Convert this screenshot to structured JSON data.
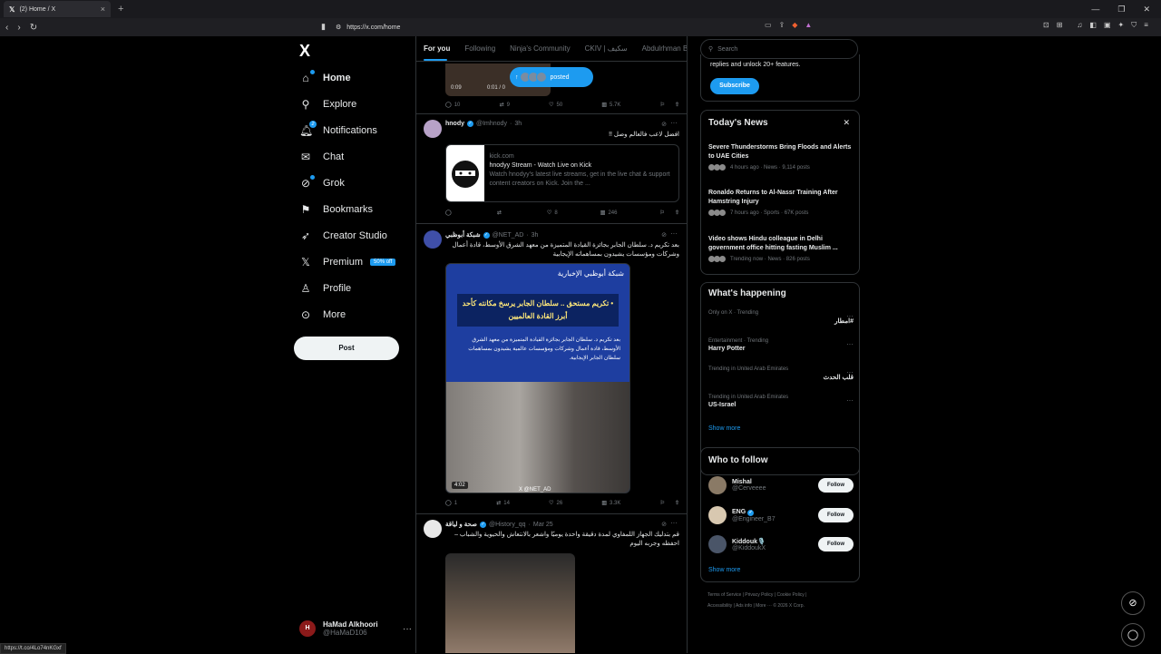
{
  "browser": {
    "tab_title": "(2) Home / X",
    "url": "https://x.com/home",
    "status_url": "https://t.co/4Lo74nKGxf"
  },
  "sidebar": {
    "logo": "X",
    "items": [
      {
        "label": "Home",
        "icon": "home-icon"
      },
      {
        "label": "Explore",
        "icon": "search-icon"
      },
      {
        "label": "Notifications",
        "icon": "bell-icon",
        "badge": "2"
      },
      {
        "label": "Chat",
        "icon": "mail-icon"
      },
      {
        "label": "Grok",
        "icon": "grok-icon"
      },
      {
        "label": "Bookmarks",
        "icon": "bookmark-icon"
      },
      {
        "label": "Creator Studio",
        "icon": "rocket-icon"
      },
      {
        "label": "Premium",
        "icon": "x-icon",
        "promo": "50% off"
      },
      {
        "label": "Profile",
        "icon": "person-icon"
      },
      {
        "label": "More",
        "icon": "more-circle-icon"
      }
    ],
    "post_label": "Post",
    "account": {
      "name": "HaMad Alkhoori",
      "handle": "@HaMaD106",
      "avatar_initials": "H"
    }
  },
  "main": {
    "tabs": [
      "For you",
      "Following",
      "Ninja's Community",
      "CKIV | سكيف",
      "Abdulrhman Bin"
    ],
    "posted_pill": "posted",
    "tweet0": {
      "video_time": "0:09",
      "video_progress": "0:01 / 0",
      "actions": {
        "replies": "10",
        "reposts": "9",
        "likes": "50",
        "views": "5.7K"
      }
    },
    "tweet1": {
      "name": "hnody",
      "handle": "@Imhnody",
      "time": "3h",
      "text": "افضل لاعب فالعالم وصل !!",
      "card": {
        "domain": "kick.com",
        "title": "hnodyy Stream - Watch Live on Kick",
        "desc": "Watch hnodyy's latest live streams, get in the live chat & support content creators on Kick. Join the ..."
      },
      "actions": {
        "replies": "",
        "reposts": "",
        "likes": "8",
        "views": "246"
      }
    },
    "tweet2": {
      "name": "شبكة أبوظبي",
      "handle": "@NET_AD",
      "time": "3h",
      "text": "بعد تكريم د. سلطان الجابر بجائزة القيادة المتميزة من معهد الشرق الأوسط، قادة أعمال وشركات ومؤسسات يشيدون بمساهماته الإيجابية",
      "media": {
        "brand": "شبكة أبوظبي الإخبارية",
        "headline": "• تكريم مستحق .. سلطان الجابر يرسخ مكانته كأحد أبرز القادة العالميين",
        "sub": "بعد تكريم د. سلطان الجابر بجائزة القيادة المتميزة من معهد الشرق الأوسط، قادة أعمال وشركات ومؤسسات عالمية يشيدون بمساهمات سلطان الجابر الإيجابية.",
        "duration": "4:02",
        "watermark": "X @NET_AD"
      },
      "actions": {
        "replies": "1",
        "reposts": "14",
        "likes": "26",
        "views": "3.3K"
      }
    },
    "tweet3": {
      "name": "صحة و لياقة",
      "handle": "@History_qq",
      "time": "Mar 25",
      "text": "قم بتدليك الجهاز اللمفاوي لمدة دقيقة واحدة يوميًا واشعر بالانتعاش والحيوية والشباب – احفظه وجربه اليوم"
    }
  },
  "right": {
    "search_placeholder": "Search",
    "premium_text": "replies and unlock 20+ features.",
    "subscribe_label": "Subscribe",
    "news": {
      "title": "Today's News",
      "items": [
        {
          "title": "Severe Thunderstorms Bring Floods and Alerts to UAE Cities",
          "meta": "4 hours ago · News · 9,114 posts"
        },
        {
          "title": "Ronaldo Returns to Al-Nassr Training After Hamstring Injury",
          "meta": "7 hours ago · Sports · 67K posts"
        },
        {
          "title": "Video shows Hindu colleague in Delhi government office hitting fasting Muslim ...",
          "meta": "Trending now · News · 826 posts"
        }
      ]
    },
    "happening": {
      "title": "What's happening",
      "items": [
        {
          "context": "Only on X · Trending",
          "topic": "#امطار"
        },
        {
          "context": "Entertainment · Trending",
          "topic": "Harry Potter"
        },
        {
          "context": "Trending in United Arab Emirates",
          "topic": "قلب الحدث"
        },
        {
          "context": "Trending in United Arab Emirates",
          "topic": "US-Israel"
        }
      ],
      "show_more": "Show more"
    },
    "who_to_follow": {
      "title": "Who to follow",
      "items": [
        {
          "name": "Mishal",
          "handle": "@Cerveeee",
          "button": "Follow"
        },
        {
          "name": "ENG",
          "handle": "@Engineer_B7",
          "button": "Follow"
        },
        {
          "name": "Kiddouk🎙️",
          "handle": "@KiddoukX",
          "button": "Follow"
        }
      ],
      "show_more": "Show more"
    },
    "footer": {
      "line1": "Terms of Service  |  Privacy Policy  |  Cookie Policy  |",
      "line2": "Accessibility  |  Ads info  |  More ···  © 2026 X Corp."
    }
  },
  "colors": {
    "accent": "#1d9bf0",
    "background": "#000000",
    "border": "#2f3336"
  }
}
